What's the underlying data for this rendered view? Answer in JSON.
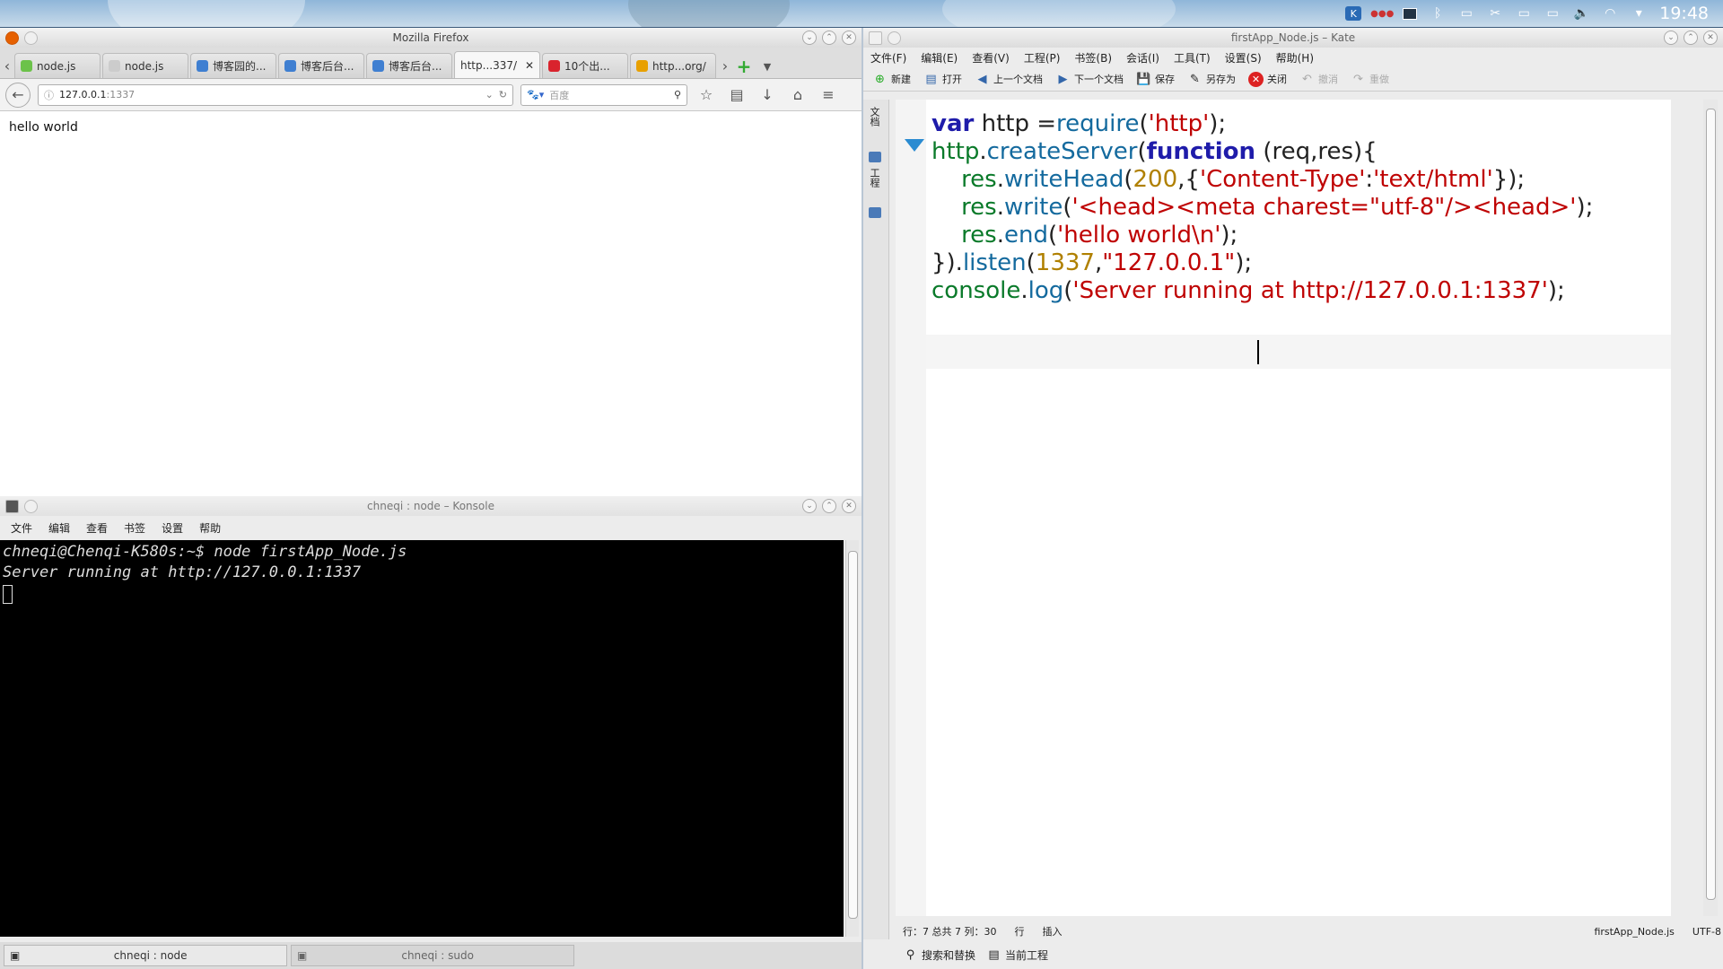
{
  "panel": {
    "clock": "19:48",
    "tray_icons": [
      "kde-icon",
      "app-dots-icon",
      "monitor-icon",
      "bluetooth-icon",
      "battery-icon",
      "network-icon",
      "keyboard-icon",
      "display-icon",
      "volume-icon",
      "wifi-icon",
      "dropdown-icon"
    ]
  },
  "firefox": {
    "title": "Mozilla Firefox",
    "tabs": [
      {
        "label": "node.js",
        "color": "#6cc24a"
      },
      {
        "label": "node.js",
        "color": "#cccccc"
      },
      {
        "label": "博客园的...",
        "color": "#3f7fd1"
      },
      {
        "label": "博客后台...",
        "color": "#3f7fd1"
      },
      {
        "label": "博客后台...",
        "color": "#3f7fd1"
      },
      {
        "label": "http...337/",
        "color": ""
      },
      {
        "label": "10个出...",
        "color": "#d9232d"
      },
      {
        "label": "http...org/",
        "color": "#e8a000"
      }
    ],
    "url_host": "127.0.0.1",
    "url_port": ":1337",
    "search_placeholder": "百度",
    "page_text": "hello world"
  },
  "konsole": {
    "title": "chneqi : node – Konsole",
    "menu": [
      "文件",
      "编辑",
      "查看",
      "书签",
      "设置",
      "帮助"
    ],
    "lines": [
      "chneqi@Chenqi-K580s:~$ node firstApp_Node.js",
      "Server running at http://127.0.0.1:1337"
    ],
    "tabs": [
      "chneqi : node",
      "chneqi : sudo"
    ]
  },
  "kate": {
    "title": "firstApp_Node.js – Kate",
    "menu": [
      "文件(F)",
      "编辑(E)",
      "查看(V)",
      "工程(P)",
      "书签(B)",
      "会话(I)",
      "工具(T)",
      "设置(S)",
      "帮助(H)"
    ],
    "toolbar": {
      "new": "新建",
      "open": "打开",
      "prev_doc": "上一个文档",
      "next_doc": "下一个文档",
      "save": "保存",
      "save_as": "另存为",
      "close": "关闭",
      "undo": "撤消",
      "redo": "重做"
    },
    "sidebar_labels": [
      "文档",
      "工程"
    ],
    "code": [
      [
        {
          "t": "var",
          "c": "kw"
        },
        {
          "t": " http =",
          "c": "tx"
        },
        {
          "t": "require",
          "c": "fn"
        },
        {
          "t": "(",
          "c": "tx"
        },
        {
          "t": "'http'",
          "c": "st"
        },
        {
          "t": ");",
          "c": "tx"
        }
      ],
      [
        {
          "t": "http",
          "c": "ob"
        },
        {
          "t": ".",
          "c": "tx"
        },
        {
          "t": "createServer",
          "c": "fn"
        },
        {
          "t": "(",
          "c": "tx"
        },
        {
          "t": "function",
          "c": "kw"
        },
        {
          "t": " (req,res){",
          "c": "tx"
        }
      ],
      [
        {
          "t": "    ",
          "c": "tx"
        },
        {
          "t": "res",
          "c": "ob"
        },
        {
          "t": ".",
          "c": "tx"
        },
        {
          "t": "writeHead",
          "c": "fn"
        },
        {
          "t": "(",
          "c": "tx"
        },
        {
          "t": "200",
          "c": "nm"
        },
        {
          "t": ",{",
          "c": "tx"
        },
        {
          "t": "'Content-Type'",
          "c": "st"
        },
        {
          "t": ":",
          "c": "tx"
        },
        {
          "t": "'text/html'",
          "c": "st"
        },
        {
          "t": "});",
          "c": "tx"
        }
      ],
      [
        {
          "t": "    ",
          "c": "tx"
        },
        {
          "t": "res",
          "c": "ob"
        },
        {
          "t": ".",
          "c": "tx"
        },
        {
          "t": "write",
          "c": "fn"
        },
        {
          "t": "(",
          "c": "tx"
        },
        {
          "t": "'<head><meta charest=\"utf-8\"/><head>'",
          "c": "st"
        },
        {
          "t": ");",
          "c": "tx"
        }
      ],
      [
        {
          "t": "    ",
          "c": "tx"
        },
        {
          "t": "res",
          "c": "ob"
        },
        {
          "t": ".",
          "c": "tx"
        },
        {
          "t": "end",
          "c": "fn"
        },
        {
          "t": "(",
          "c": "tx"
        },
        {
          "t": "'hello world\\n'",
          "c": "st"
        },
        {
          "t": ");",
          "c": "tx"
        }
      ],
      [
        {
          "t": "}).",
          "c": "tx"
        },
        {
          "t": "listen",
          "c": "fn"
        },
        {
          "t": "(",
          "c": "tx"
        },
        {
          "t": "1337",
          "c": "nm"
        },
        {
          "t": ",",
          "c": "tx"
        },
        {
          "t": "\"127.0.0.1\"",
          "c": "st"
        },
        {
          "t": ");",
          "c": "tx"
        }
      ],
      [
        {
          "t": "console",
          "c": "ob"
        },
        {
          "t": ".",
          "c": "tx"
        },
        {
          "t": "log",
          "c": "fn"
        },
        {
          "t": "(",
          "c": "tx"
        },
        {
          "t": "'Server running at http://127.0.0.1:1337'",
          "c": "st"
        },
        {
          "t": ");",
          "c": "tx"
        }
      ]
    ],
    "status_pos": "行：7 总共 7 列：30",
    "status_mode": "行",
    "status_insert": "插入",
    "status_file": "firstApp_Node.js",
    "status_encoding": "UTF-8",
    "bottom_search": "搜索和替换",
    "bottom_project": "当前工程"
  }
}
